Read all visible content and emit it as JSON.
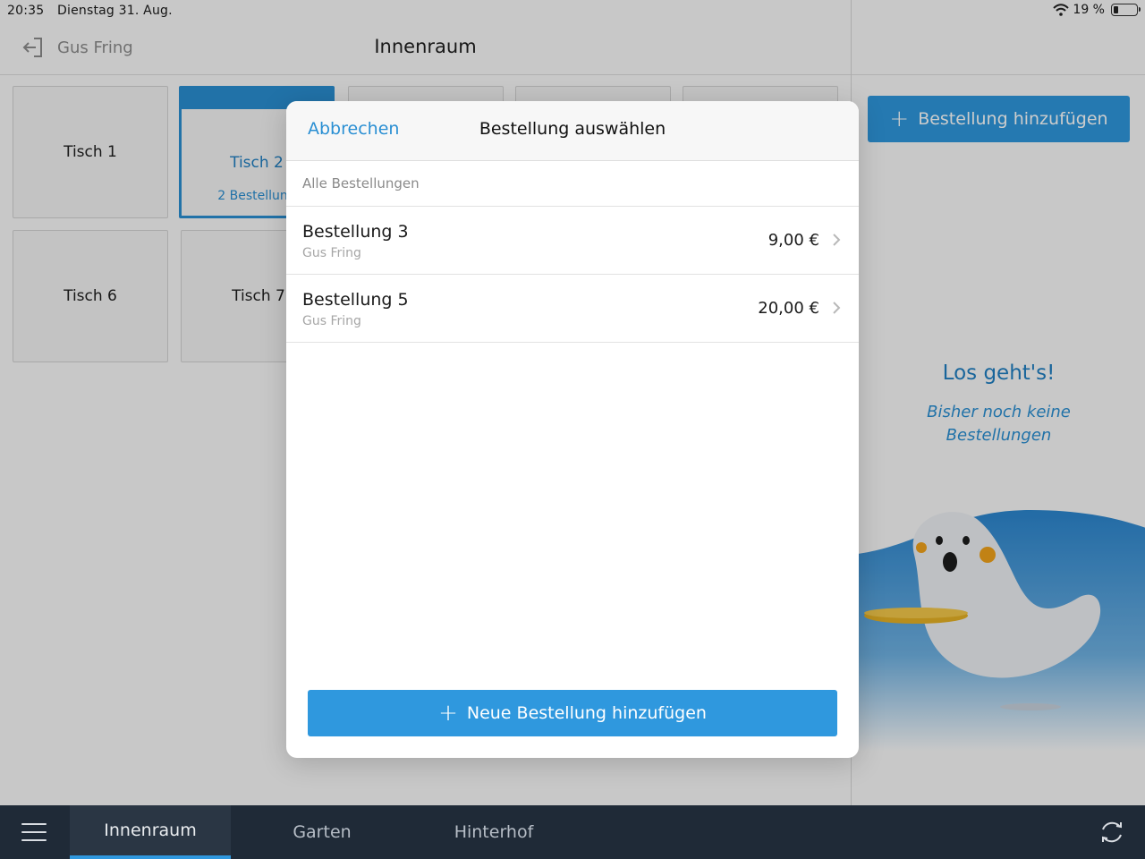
{
  "status_bar": {
    "time": "20:35",
    "date": "Dienstag 31. Aug.",
    "battery_text": "19 %",
    "battery_level": 0.19
  },
  "header": {
    "user_name": "Gus Fring",
    "title": "Innenraum"
  },
  "tables": [
    {
      "label": "Tisch 1",
      "sub": ""
    },
    {
      "label": "Tisch 2",
      "sub": "2 Bestellung"
    },
    {
      "label": "",
      "sub": ""
    },
    {
      "label": "",
      "sub": ""
    },
    {
      "label": "",
      "sub": ""
    },
    {
      "label": "Tisch 6",
      "sub": ""
    },
    {
      "label": "Tisch 7",
      "sub": ""
    }
  ],
  "right_panel": {
    "add_button_label": "Bestellung hinzufügen",
    "empty_title": "Los geht's!",
    "empty_subtitle": "Bisher noch keine Bestellungen"
  },
  "modal": {
    "cancel_label": "Abbrechen",
    "title": "Bestellung auswählen",
    "section_label": "Alle Bestellungen",
    "orders": [
      {
        "name": "Bestellung 3",
        "user": "Gus Fring",
        "price": "9,00 €"
      },
      {
        "name": "Bestellung 5",
        "user": "Gus Fring",
        "price": "20,00 €"
      }
    ],
    "new_order_label": "Neue Bestellung hinzufügen"
  },
  "tabbar": {
    "tabs": [
      {
        "label": "Innenraum",
        "active": true
      },
      {
        "label": "Garten",
        "active": false
      },
      {
        "label": "Hinterhof",
        "active": false
      }
    ]
  },
  "colors": {
    "accent": "#2f98de",
    "tabbar_bg": "#1f2a37",
    "active_tab_bg": "#2a3644"
  }
}
